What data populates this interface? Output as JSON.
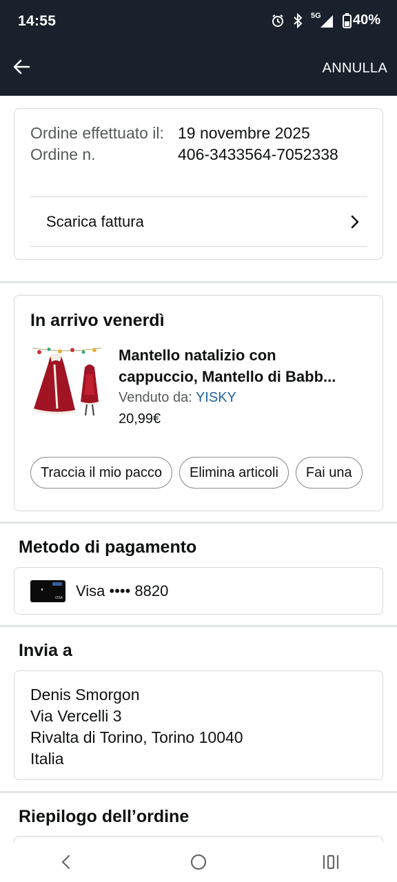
{
  "status_bar": {
    "time": "14:55",
    "network": "5G",
    "battery": "40%",
    "icons": [
      "alarm-icon",
      "bluetooth-icon",
      "signal-icon",
      "battery-icon"
    ]
  },
  "app_bar": {
    "back_icon": "arrow-left-icon",
    "cancel_label": "ANNULLA"
  },
  "order_info": {
    "date_label": "Ordine effettuato il:",
    "date_value": "19 novembre 2025",
    "number_label": "Ordine n.",
    "number_value": "406-3433564-7052338",
    "invoice_label": "Scarica fattura"
  },
  "arrival": {
    "title": "In arrivo venerdì",
    "product": {
      "title_line1": "Mantello natalizio con",
      "title_line2": "cappuccio, Mantello di Babb...",
      "seller_label": "Venduto da: ",
      "seller_name": "YISKY",
      "price": "20,99€"
    },
    "actions": [
      "Traccia il mio pacco",
      "Elimina articoli",
      "Fai una"
    ]
  },
  "payment": {
    "title": "Metodo di pagamento",
    "card_text": "Visa •••• 8820"
  },
  "shipping": {
    "title": "Invia a",
    "address": [
      "Denis Smorgon",
      "Via Vercelli 3",
      "Rivalta di Torino, Torino 10040",
      "Italia"
    ]
  },
  "summary": {
    "title": "Riepilogo dell’ordine"
  },
  "colors": {
    "header_bg": "#1a212c",
    "link": "#2162a1",
    "text": "#0f1111",
    "muted": "#565959"
  },
  "nav_bar": {
    "icons": [
      "back-nav-icon",
      "home-nav-icon",
      "recents-nav-icon"
    ]
  }
}
